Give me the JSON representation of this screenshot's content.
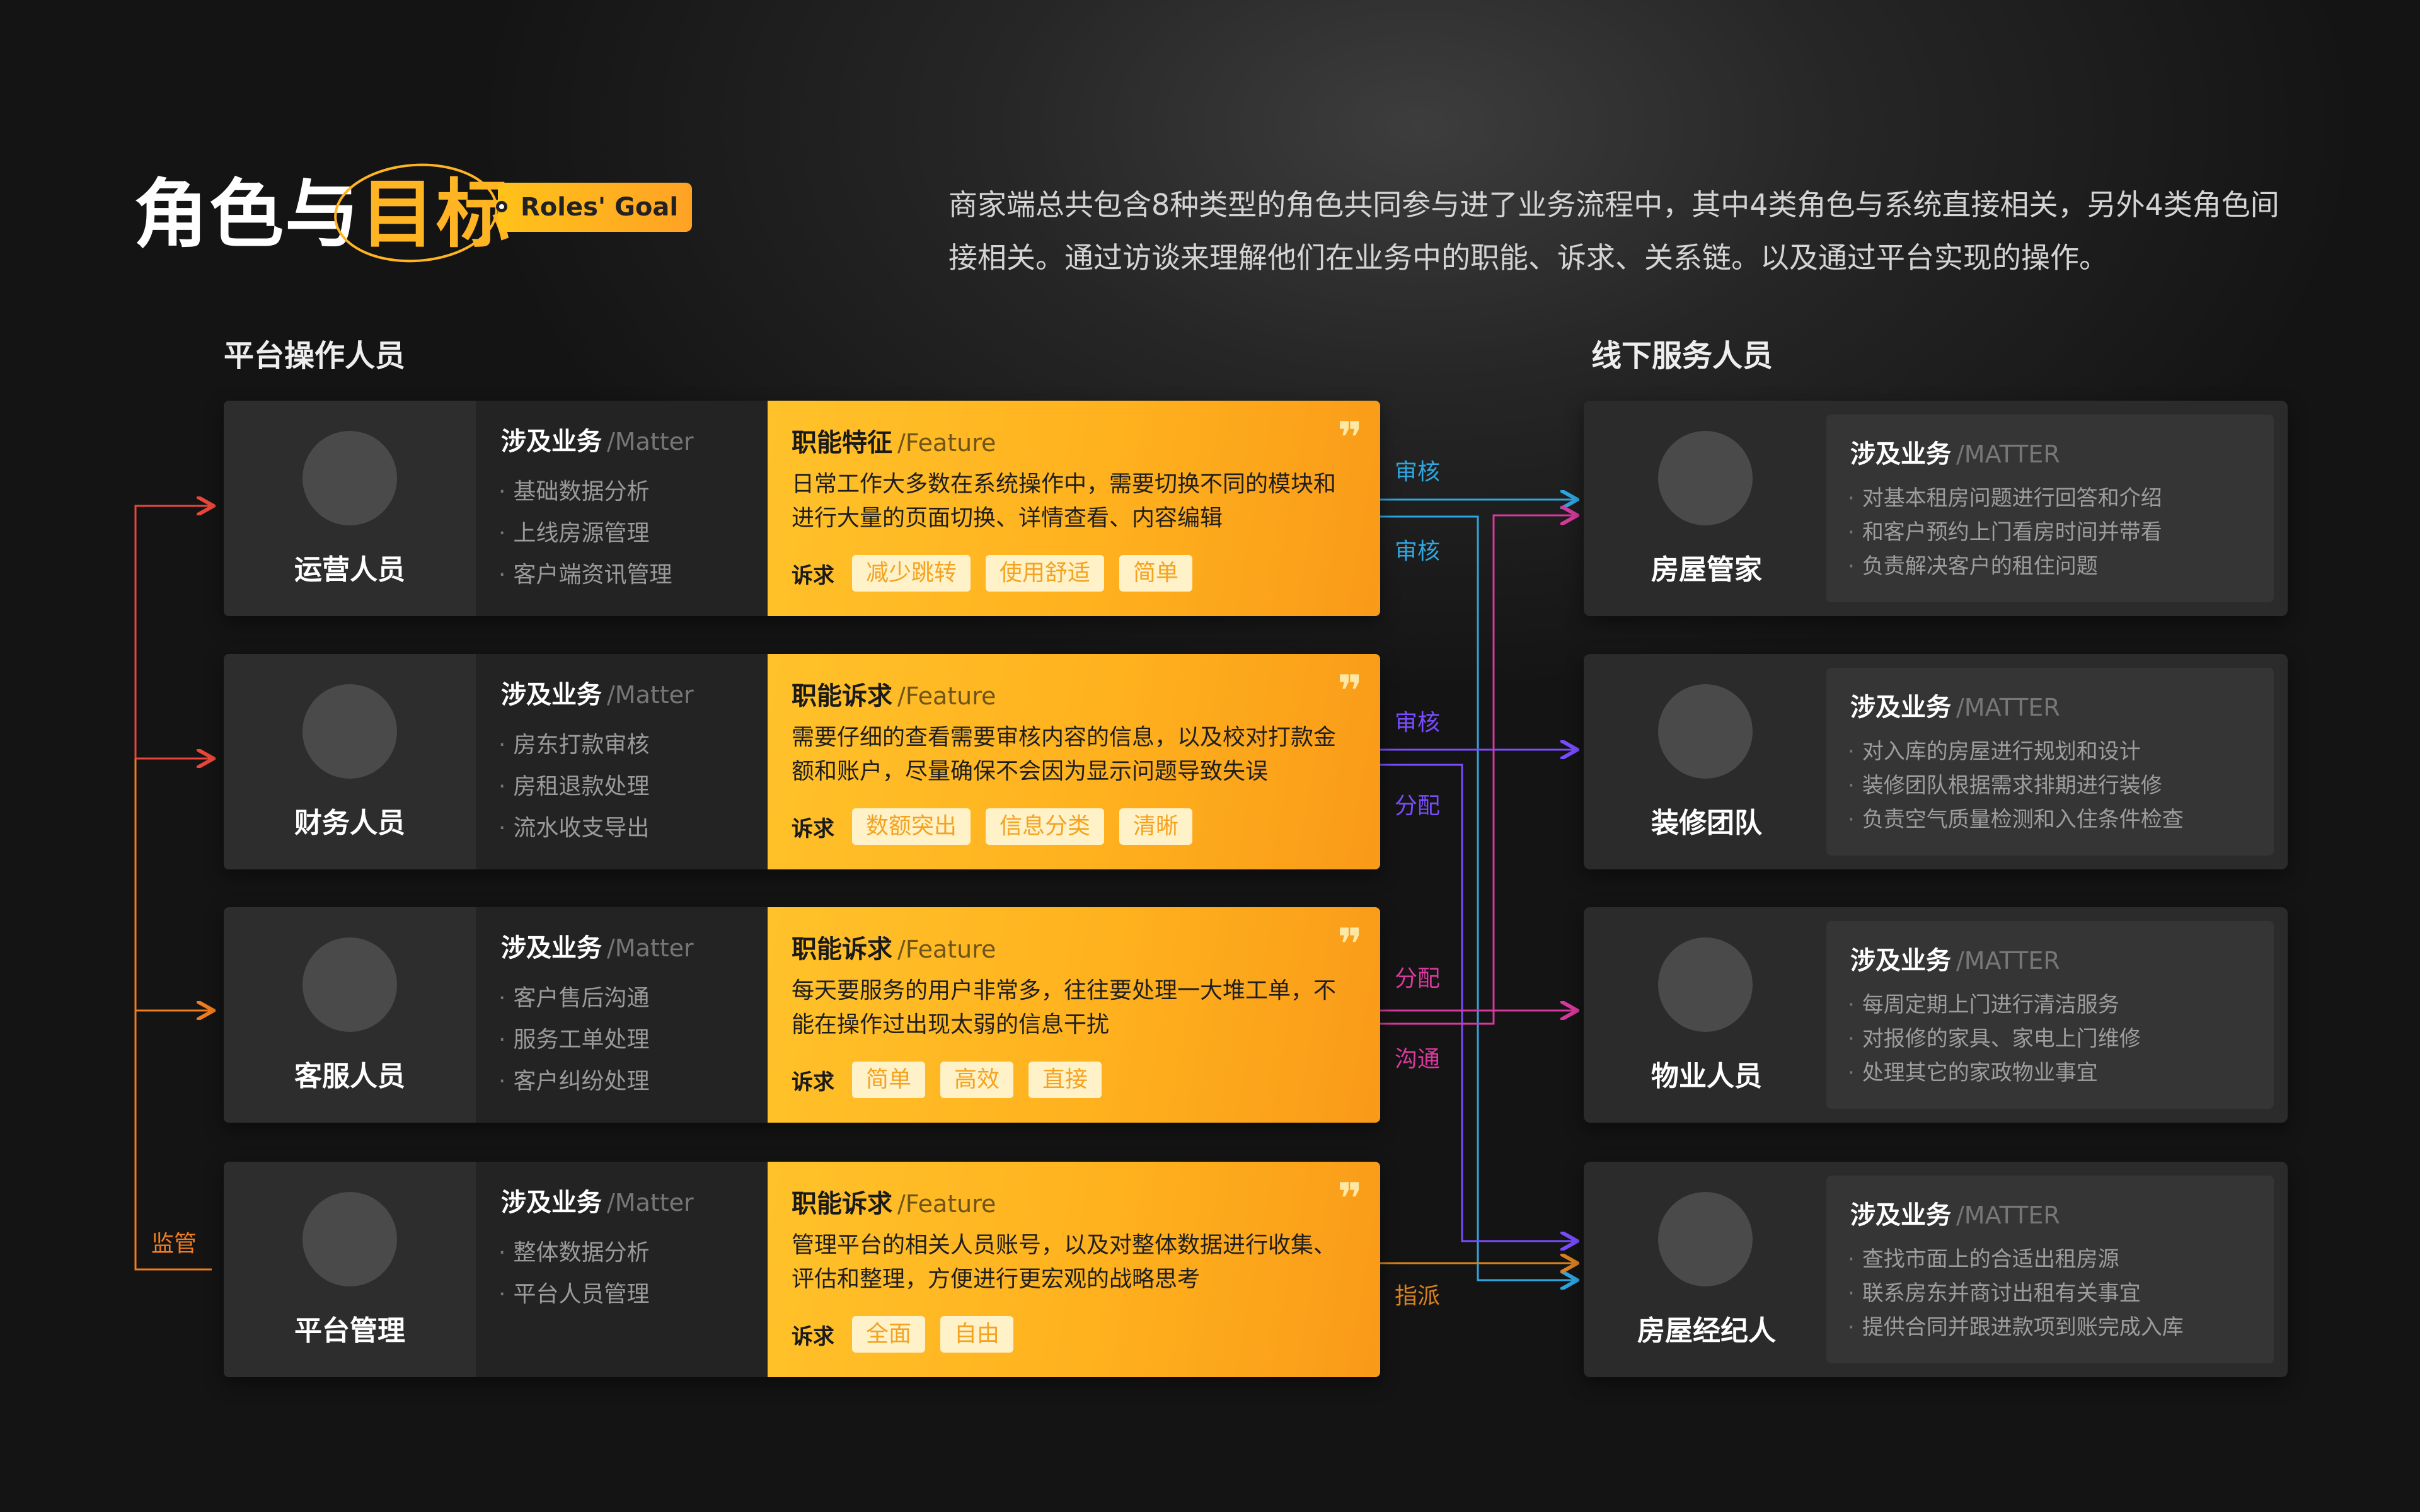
{
  "header": {
    "title_part1": "角色与",
    "title_part2": "目标",
    "tag": "Roles' Goal",
    "intro": "商家端总共包含8种类型的角色共同参与进了业务流程中，其中4类角色与系统直接相关，另外4类角色间接相关。通过访谈来理解他们在业务中的职能、诉求、关系链。以及通过平台实现的操作。"
  },
  "sections": {
    "left": "平台操作人员",
    "right": "线下服务人员"
  },
  "common": {
    "matter_cn": "涉及业务",
    "matter_en": "/Matter",
    "matter_en_upper": "/MATTER",
    "feature_en": "/Feature",
    "req_label": "诉求",
    "quote": "❞"
  },
  "left_roles": [
    {
      "name": "运营人员",
      "matters": [
        "基础数据分析",
        "上线房源管理",
        "客户端资讯管理"
      ],
      "feature_title": "职能特征",
      "feature_desc": "日常工作大多数在系统操作中，需要切换不同的模块和进行大量的页面切换、详情查看、内容编辑",
      "requests": [
        "减少跳转",
        "使用舒适",
        "简单"
      ]
    },
    {
      "name": "财务人员",
      "matters": [
        "房东打款审核",
        "房租退款处理",
        "流水收支导出"
      ],
      "feature_title": "职能诉求",
      "feature_desc": "需要仔细的查看需要审核内容的信息，以及校对打款金额和账户，尽量确保不会因为显示问题导致失误",
      "requests": [
        "数额突出",
        "信息分类",
        "清晰"
      ]
    },
    {
      "name": "客服人员",
      "matters": [
        "客户售后沟通",
        "服务工单处理",
        "客户纠纷处理"
      ],
      "feature_title": "职能诉求",
      "feature_desc": "每天要服务的用户非常多，往往要处理一大堆工单，不能在操作过出现太弱的信息干扰",
      "requests": [
        "简单",
        "高效",
        "直接"
      ]
    },
    {
      "name": "平台管理",
      "matters": [
        "整体数据分析",
        "平台人员管理"
      ],
      "feature_title": "职能诉求",
      "feature_desc": "管理平台的相关人员账号，以及对整体数据进行收集、评估和整理，方便进行更宏观的战略思考",
      "requests": [
        "全面",
        "自由"
      ]
    }
  ],
  "right_roles": [
    {
      "name": "房屋管家",
      "matters": [
        "对基本租房问题进行回答和介绍",
        "和客户预约上门看房时间并带看",
        "负责解决客户的租住问题"
      ]
    },
    {
      "name": "装修团队",
      "matters": [
        "对入库的房屋进行规划和设计",
        "装修团队根据需求排期进行装修",
        "负责空气质量检测和入住条件检查"
      ]
    },
    {
      "name": "物业人员",
      "matters": [
        "每周定期上门进行清洁服务",
        "对报修的家具、家电上门维修",
        "处理其它的家政物业事宜"
      ]
    },
    {
      "name": "房屋经纪人",
      "matters": [
        "查找市面上的合适出租房源",
        "联系房东并商讨出租有关事宜",
        "提供合同并跟进款项到账完成入库"
      ]
    }
  ],
  "connectors": {
    "supervise": "监管",
    "labels": [
      "审核",
      "审核",
      "审核",
      "分配",
      "分配",
      "沟通",
      "指派"
    ]
  },
  "colors": {
    "accent": "#ffb423",
    "red": "#e8473a",
    "orange": "#f07c1e",
    "blue": "#2ea6e0",
    "purple": "#7a4cff",
    "magenta": "#d8399e",
    "amber": "#d9821f"
  }
}
